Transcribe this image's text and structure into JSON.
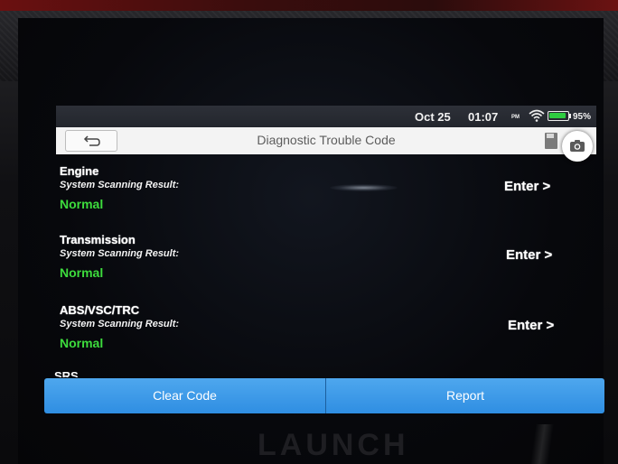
{
  "status_bar": {
    "date": "Oct 25",
    "time": "01:07",
    "ampm": "PM",
    "battery_percent": "95%",
    "battery_level": 0.95
  },
  "header": {
    "title": "Diagnostic Trouble Code",
    "icons": {
      "back": "back-arrow-icon",
      "save": "save-icon",
      "camera": "camera-icon"
    }
  },
  "systems": [
    {
      "name": "Engine",
      "result_label": "System Scanning Result:",
      "result": "Normal",
      "action": "Enter >"
    },
    {
      "name": "Transmission",
      "result_label": "System Scanning Result:",
      "result": "Normal",
      "action": "Enter >"
    },
    {
      "name": "ABS/VSC/TRC",
      "result_label": "System Scanning Result:",
      "result": "Normal",
      "action": "Enter >"
    },
    {
      "name": "SRS Airbag"
    }
  ],
  "footer": {
    "clear_code": "Clear Code",
    "report": "Report"
  },
  "device": {
    "brand": "LAUNCH"
  },
  "colors": {
    "accent_blue": "#3a9be8",
    "normal_green": "#3ddc3d",
    "battery_green": "#2ecc40"
  }
}
